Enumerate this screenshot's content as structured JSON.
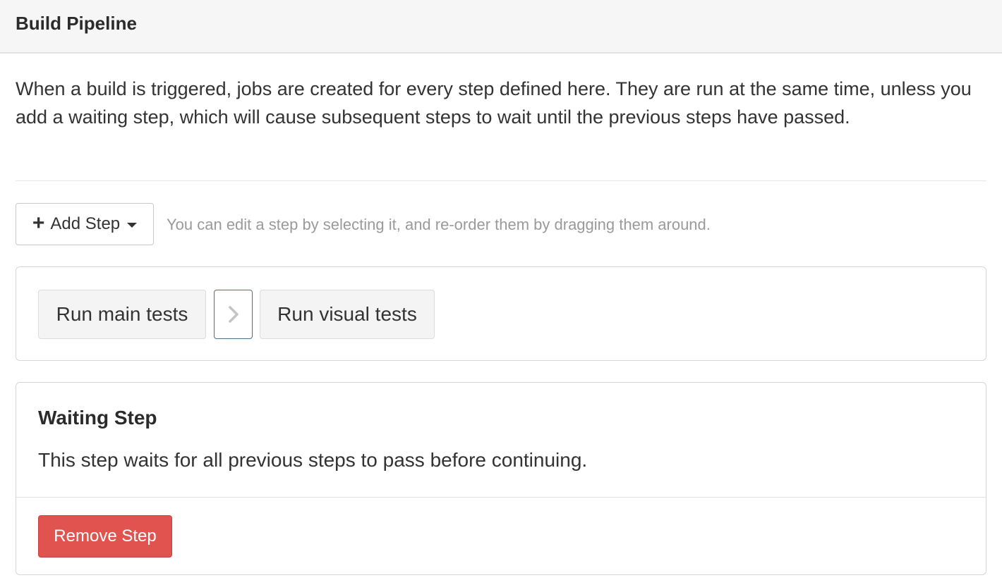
{
  "header": {
    "title": "Build Pipeline"
  },
  "intro": "When a build is triggered, jobs are created for every step defined here. They are run at the same time, unless you add a waiting step, which will cause subsequent steps to wait until the previous steps have passed.",
  "toolbar": {
    "add_step_icon": "plus-icon",
    "add_step_label": "Add Step",
    "add_step_caret": "caret-down-icon",
    "hint": "You can edit a step by selecting it, and re-order them by dragging them around."
  },
  "pipeline": {
    "steps": [
      {
        "label": "Run main tests"
      },
      {
        "label": "Run visual tests"
      }
    ],
    "wait_icon": "chevron-right-icon"
  },
  "detail": {
    "title": "Waiting Step",
    "description": "This step waits for all previous steps to pass before continuing.",
    "remove_label": "Remove Step"
  },
  "colors": {
    "danger": "#e0534e",
    "wait_border": "#4a6e8e"
  }
}
